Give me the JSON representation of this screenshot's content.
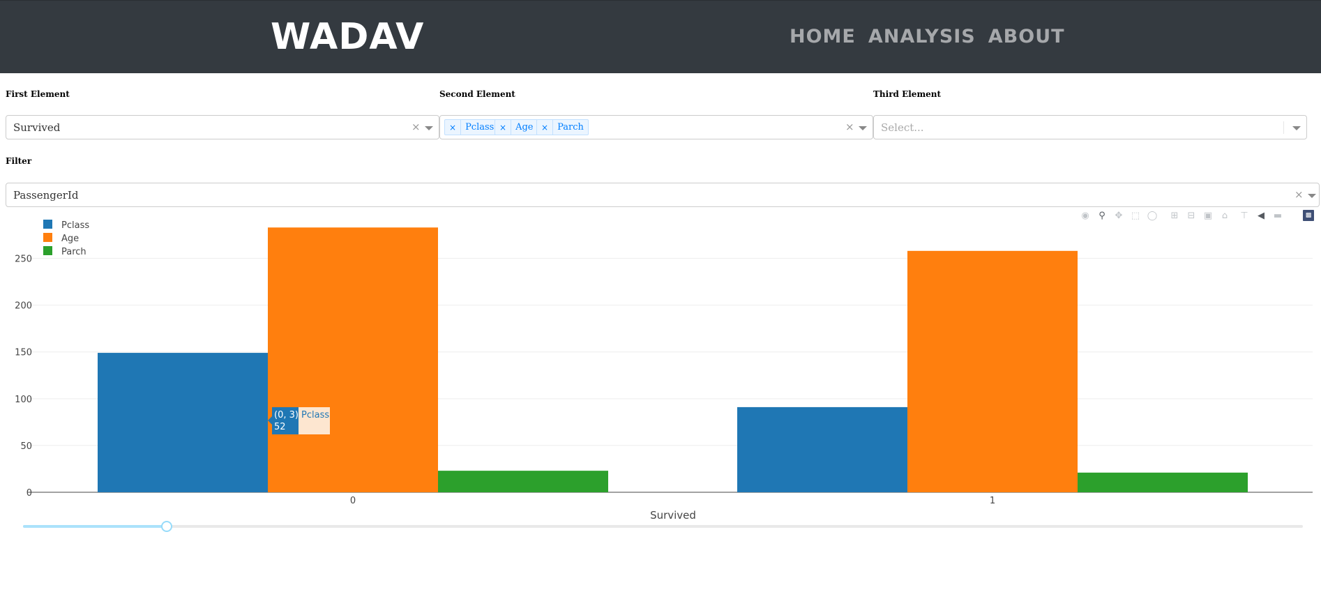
{
  "app": {
    "brand": "WADAV"
  },
  "nav": {
    "items": [
      "HOME",
      "ANALYSIS",
      "ABOUT"
    ]
  },
  "controls": {
    "first": {
      "label": "First Element",
      "value": "Survived",
      "clear": "×"
    },
    "second": {
      "label": "Second Element",
      "tags": [
        "Pclass",
        "Age",
        "Parch"
      ],
      "tag_remove": "×",
      "clear": "×"
    },
    "third": {
      "label": "Third Element",
      "placeholder": "Select..."
    },
    "filter": {
      "label": "Filter",
      "value": "PassengerId",
      "clear": "×"
    }
  },
  "modebar": {
    "icons": [
      "camera-icon",
      "zoom-icon",
      "pan-icon",
      "box-select-icon",
      "lasso-icon",
      "zoom-in-icon",
      "zoom-out-icon",
      "autoscale-icon",
      "reset-axes-icon",
      "spike-lines-icon",
      "hover-closest-icon",
      "hover-compare-icon",
      "plotly-logo-icon"
    ],
    "active": "zoom-icon"
  },
  "chart_data": {
    "type": "bar",
    "barmode": "group",
    "categories": [
      "0",
      "1"
    ],
    "series": [
      {
        "name": "Pclass",
        "color": "#1f77b4",
        "values": [
          149,
          91
        ]
      },
      {
        "name": "Age",
        "color": "#ff7f0e",
        "values": [
          283,
          258
        ]
      },
      {
        "name": "Parch",
        "color": "#2ca02c",
        "values": [
          23,
          21
        ]
      }
    ],
    "xlabel": "Survived",
    "ylabel": "",
    "ylim": [
      0,
      290
    ],
    "yticks": [
      0,
      50,
      100,
      150,
      200,
      250
    ],
    "grid": true,
    "legend": "top-left",
    "tooltip": {
      "series": "Pclass",
      "title": "(0, 3)",
      "value": "52"
    }
  },
  "slider": {
    "value_fraction": 0.112
  }
}
